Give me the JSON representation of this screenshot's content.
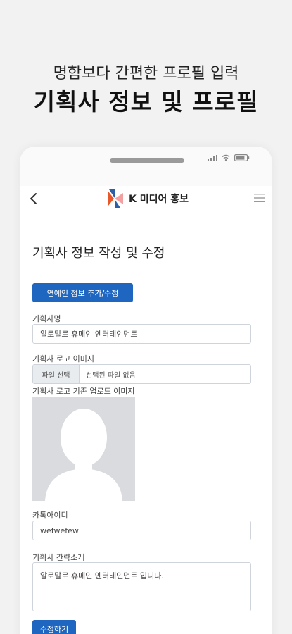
{
  "hero": {
    "subtitle": "명함보다 간편한 프로필 입력",
    "title": "기획사 정보 및 프로필"
  },
  "appbar": {
    "brand": "K 미디어 홍보",
    "back_icon": "chevron-left-icon",
    "menu_icon": "hamburger-menu-icon"
  },
  "form": {
    "title": "기획사 정보 작성 및 수정",
    "add_button": "연예인 정보 추가/수정",
    "agency_name_label": "기획사명",
    "agency_name_value": "알로말로 휴메인 엔터테인먼트",
    "logo_label": "기획사 로고 이미지",
    "file_button": "파일 선택",
    "file_status": "선택된 파일 없음",
    "existing_logo_label": "기획사 로고 기존 업로드 이미지",
    "kakao_label": "카톡아이디",
    "kakao_value": "wefwefew",
    "intro_label": "기획사 간략소개",
    "intro_value": "알로말로 휴메인 엔터테인먼트 입니다.",
    "submit_button": "수정하기"
  },
  "colors": {
    "primary": "#1f66c0",
    "brand_orange": "#e8572a",
    "brand_blue": "#2c5fa8"
  }
}
